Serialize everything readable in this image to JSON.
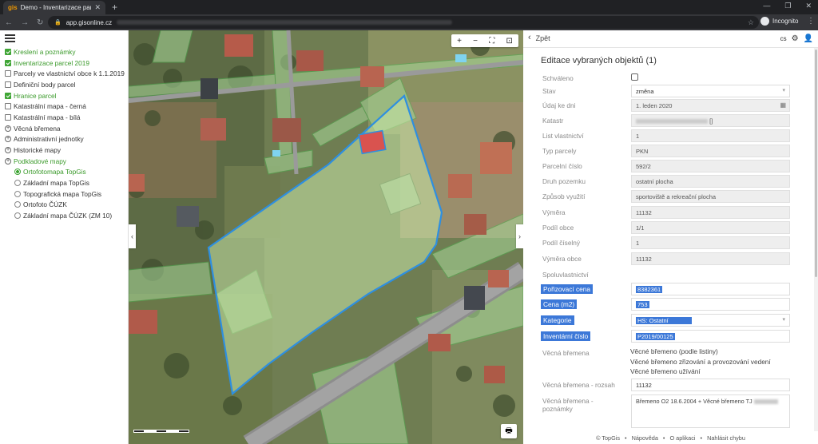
{
  "browser": {
    "tab_title": "Demo - Inventarizace parcel obc...",
    "tab_favicon": "gis",
    "url": "app.gisonline.cz",
    "profile_label": "Incognito"
  },
  "layers_panel": {
    "items": [
      {
        "type": "checkbox",
        "label": "Kreslení a poznámky",
        "checked": true
      },
      {
        "type": "checkbox",
        "label": "Inventarizace parcel 2019",
        "checked": true
      },
      {
        "type": "checkbox",
        "label": "Parcely ve vlastnictví obce k 1.1.2019",
        "checked": false
      },
      {
        "type": "checkbox",
        "label": "Definiční body parcel",
        "checked": false
      },
      {
        "type": "checkbox",
        "label": "Hranice parcel",
        "checked": true
      },
      {
        "type": "checkbox",
        "label": "Katastrální mapa - černá",
        "checked": false
      },
      {
        "type": "checkbox",
        "label": "Katastrální mapa - bílá",
        "checked": false
      },
      {
        "type": "expand",
        "label": "Věcná břemena",
        "active": false
      },
      {
        "type": "expand",
        "label": "Administrativní jednotky",
        "active": false
      },
      {
        "type": "expand",
        "label": "Historické mapy",
        "active": false
      },
      {
        "type": "expand",
        "label": "Podkladové mapy",
        "active": true
      },
      {
        "type": "radio",
        "label": "Ortofotomapa TopGis",
        "checked": true
      },
      {
        "type": "radio",
        "label": "Základní mapa TopGis",
        "checked": false
      },
      {
        "type": "radio",
        "label": "Topografická mapa TopGis",
        "checked": false
      },
      {
        "type": "radio",
        "label": "Ortofoto ČÚZK",
        "checked": false
      },
      {
        "type": "radio",
        "label": "Základní mapa ČÚZK (ZM 10)",
        "checked": false
      }
    ]
  },
  "map": {
    "controls": [
      "+",
      "−",
      "⛶",
      "⊡"
    ]
  },
  "detail": {
    "back_label": "Zpět",
    "lang": "cs",
    "title": "Editace vybraných objektů (1)",
    "fields": {
      "schvaleno": {
        "label": "Schváleno"
      },
      "stav": {
        "label": "Stav",
        "value": "změna"
      },
      "udaj": {
        "label": "Údaj ke dni",
        "value": "1. leden 2020"
      },
      "katastr": {
        "label": "Katastr",
        "value": "[]"
      },
      "list": {
        "label": "List vlastnictví",
        "value": "1"
      },
      "typ": {
        "label": "Typ parcely",
        "value": "PKN"
      },
      "cislo": {
        "label": "Parcelní číslo",
        "value": "592/2"
      },
      "druh": {
        "label": "Druh pozemku",
        "value": "ostatní plocha"
      },
      "zpusob": {
        "label": "Způsob využití",
        "value": "sportoviště a rekreační plocha"
      },
      "vymera": {
        "label": "Výměra",
        "value": "11132"
      },
      "podil_obce": {
        "label": "Podíl obce",
        "value": "1/1"
      },
      "podil_ciselny": {
        "label": "Podíl číselný",
        "value": "1"
      },
      "vymera_obce": {
        "label": "Výměra obce",
        "value": "11132"
      },
      "spoluvlastnictvi": {
        "label": "Spoluvlastnictví"
      },
      "porizovaci": {
        "label": "Pořizovací cena",
        "value": "8382361"
      },
      "cena": {
        "label": "Cena (m2)",
        "value": "753"
      },
      "kategorie": {
        "label": "Kategorie",
        "value": "HS: Ostatní"
      },
      "inventarni": {
        "label": "Inventární číslo",
        "value": "P2019/00125"
      },
      "vecna_bremena": {
        "label": "Věcná břemena",
        "values": [
          "Věcné břemeno (podle listiny)",
          "Věcné břemeno zřizování a provozování vedení",
          "Věcné břemeno užívání"
        ]
      },
      "rozsah": {
        "label": "Věcná břemena - rozsah",
        "value": "11132"
      },
      "poznamky": {
        "label_line1": "Věcná břemena -",
        "label_line2": "poznámky",
        "value": "Břemeno O2 18.6.2004 + Věcné břemeno TJ"
      }
    },
    "footer": {
      "copyright": "© TopGis",
      "help": "Nápověda",
      "about": "O aplikaci",
      "report": "Nahlásit chybu"
    }
  }
}
